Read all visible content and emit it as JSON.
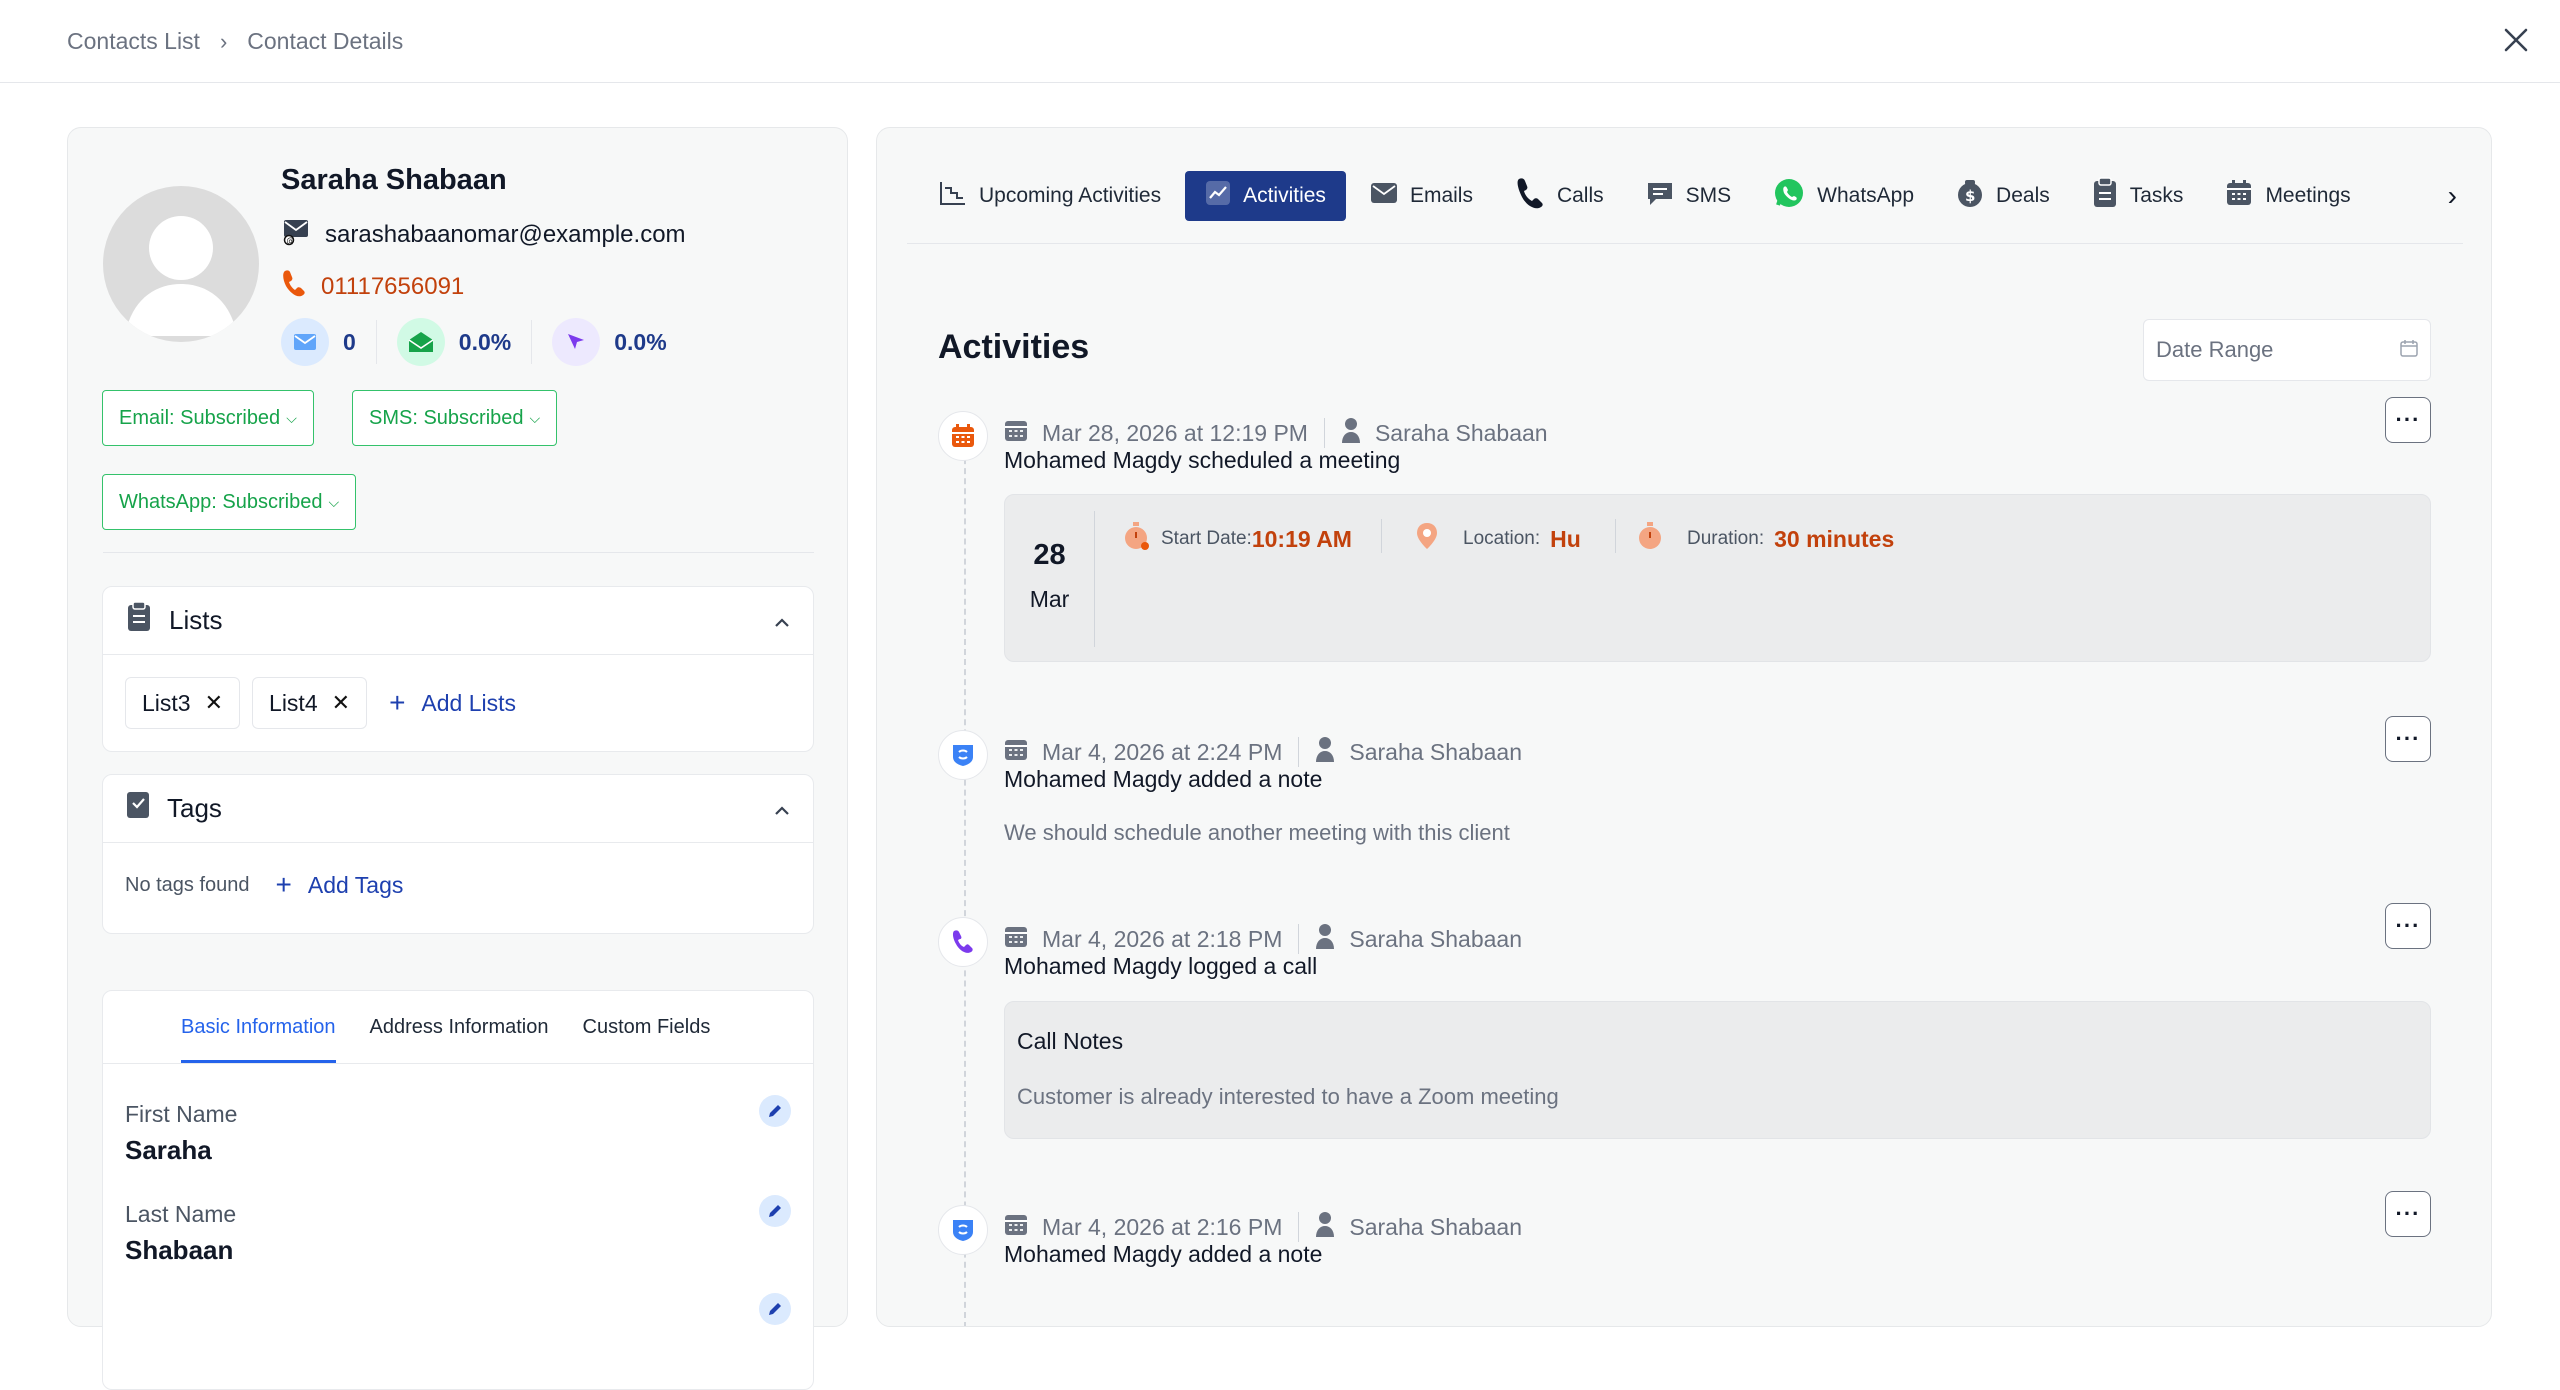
{
  "breadcrumb": {
    "items": [
      "Contacts List",
      "Contact Details"
    ]
  },
  "contact": {
    "name": "Saraha Shabaan",
    "email": "sarashabaanomar@example.com",
    "phone": "01117656091",
    "stats": {
      "emails_sent": "0",
      "open_rate": "0.0%",
      "click_rate": "0.0%"
    }
  },
  "subscriptions": {
    "email": "Email: Subscribed",
    "sms": "SMS: Subscribed",
    "whatsapp": "WhatsApp: Subscribed"
  },
  "lists_card": {
    "title": "Lists",
    "chips": [
      "List3",
      "List4"
    ],
    "add_label": "Add Lists"
  },
  "tags_card": {
    "title": "Tags",
    "empty": "No tags found",
    "add_label": "Add Tags"
  },
  "info_card": {
    "tabs": [
      "Basic Information",
      "Address Information",
      "Custom Fields"
    ],
    "active_tab": "Basic Information",
    "fields": [
      {
        "label": "First Name",
        "value": "Saraha"
      },
      {
        "label": "Last Name",
        "value": "Shabaan"
      }
    ]
  },
  "activity_tabs": [
    "Upcoming Activities",
    "Activities",
    "Emails",
    "Calls",
    "SMS",
    "WhatsApp",
    "Deals",
    "Tasks",
    "Meetings"
  ],
  "active_activity_tab": "Activities",
  "activities": {
    "title": "Activities",
    "date_range_placeholder": "Date Range",
    "entries": [
      {
        "type": "meeting",
        "datetime": "Mar 28, 2026 at 12:19 PM",
        "user": "Saraha Shabaan",
        "title": "Mohamed Magdy scheduled a meeting",
        "meeting": {
          "day": "28",
          "month": "Mar",
          "start_label": "Start Date:",
          "start_value": "10:19 AM",
          "location_label": "Location:",
          "location_value": "Hu",
          "duration_label": "Duration:",
          "duration_value": "30 minutes"
        }
      },
      {
        "type": "note",
        "datetime": "Mar 4, 2026 at 2:24 PM",
        "user": "Saraha Shabaan",
        "title": "Mohamed Magdy added a note",
        "description": "We should schedule another meeting with this client"
      },
      {
        "type": "call",
        "datetime": "Mar 4, 2026 at 2:18 PM",
        "user": "Saraha Shabaan",
        "title": "Mohamed Magdy logged a call",
        "call_notes_title": "Call Notes",
        "call_notes": "Customer is already interested to have a Zoom meeting"
      },
      {
        "type": "note",
        "datetime": "Mar 4, 2026 at 2:16 PM",
        "user": "Saraha Shabaan",
        "title": "Mohamed Magdy added a note"
      }
    ]
  },
  "colors": {
    "accent": "#1e3a8a",
    "subscribed": "#16a34a",
    "orange": "#c2410c",
    "link": "#1e40af"
  }
}
